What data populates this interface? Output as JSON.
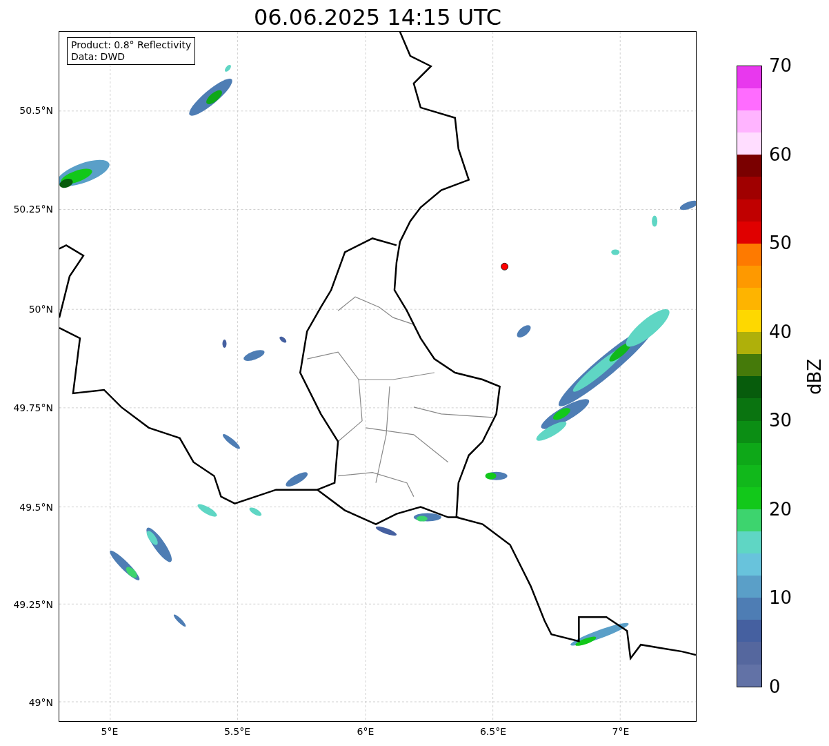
{
  "title": "06.06.2025 14:15 UTC",
  "legend": [
    "Product: 0.8° Reflectivity",
    "Data: DWD"
  ],
  "y_ticks": [
    "50.5°N",
    "50.25°N",
    "50°N",
    "49.75°N",
    "49.5°N",
    "49.25°N",
    "49°N"
  ],
  "x_ticks": [
    "5°E",
    "5.5°E",
    "6°E",
    "6.5°E",
    "7°E"
  ],
  "colorbar": {
    "label": "dBZ",
    "ticks": [
      "70",
      "60",
      "50",
      "40",
      "30",
      "20",
      "10",
      "0"
    ],
    "segments": [
      {
        "color": "#e838ee"
      },
      {
        "color": "#ff6cff"
      },
      {
        "color": "#ffb4ff"
      },
      {
        "color": "#ffddff"
      },
      {
        "color": "#7a0000"
      },
      {
        "color": "#a00000"
      },
      {
        "color": "#c00000"
      },
      {
        "color": "#e00000"
      },
      {
        "color": "#fe7a00"
      },
      {
        "color": "#fe9900"
      },
      {
        "color": "#feb400"
      },
      {
        "color": "#fed800"
      },
      {
        "color": "#afb00a"
      },
      {
        "color": "#457a0a"
      },
      {
        "color": "#075c0c"
      },
      {
        "color": "#0a7410"
      },
      {
        "color": "#0b8e14"
      },
      {
        "color": "#0ea818"
      },
      {
        "color": "#11b81b"
      },
      {
        "color": "#12c81a"
      },
      {
        "color": "#3dd46e"
      },
      {
        "color": "#5fd6c4"
      },
      {
        "color": "#68c3dc"
      },
      {
        "color": "#5a9fc8"
      },
      {
        "color": "#4e7db4"
      },
      {
        "color": "#4560a0"
      },
      {
        "color": "#55679e"
      },
      {
        "color": "#6272a6"
      }
    ]
  }
}
